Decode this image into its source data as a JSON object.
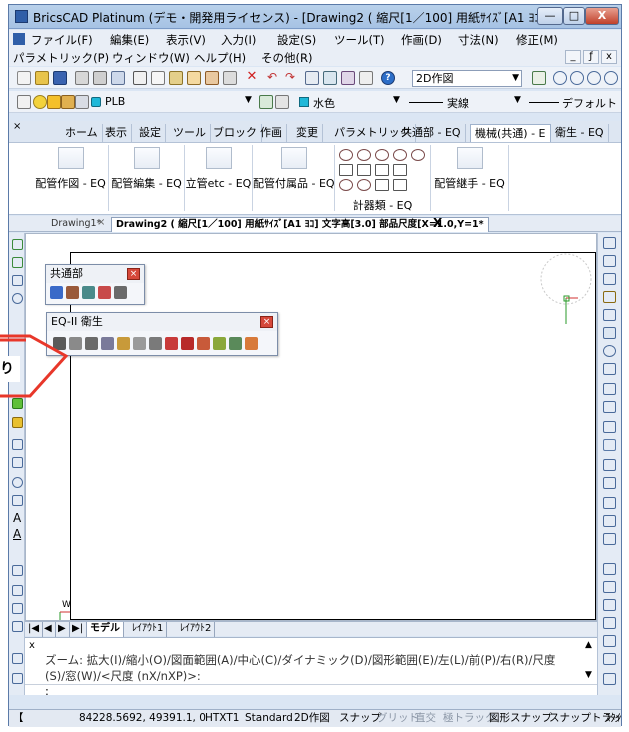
{
  "window": {
    "title": "BricsCAD Platinum (デモ・開発用ライセンス) - [Drawing2 ( 縮尺[1／100] 用紙ｻｲｽﾞ[A1 ﾖｺ] ...",
    "min": "—",
    "max": "□",
    "close": "X"
  },
  "menu": {
    "row1": [
      "ファイル(F)",
      "編集(E)",
      "表示(V)",
      "入力(I)",
      "設定(S)",
      "ツール(T)",
      "作画(D)",
      "寸法(N)",
      "修正(M)"
    ],
    "row2": [
      "パラメトリック(P)",
      "ウィンドウ(W)",
      "ヘルプ(H)",
      "その他(R)"
    ],
    "mdi_min": "_",
    "mdi_restore": "ƒ",
    "mdi_close": "x"
  },
  "toolbar1": {
    "workspace": "2D作図"
  },
  "toolbar2": {
    "layer": "PLB",
    "color": "水色",
    "linetype": "実線",
    "lineweight": "デフォルト"
  },
  "ribbon_tabs": [
    "ホーム",
    "表示",
    "設定",
    "ツール",
    "ブロック",
    "作画",
    "変更",
    "パラメトリック",
    "共通部 - EQ",
    "機械(共通) - E",
    "衛生 - EQ"
  ],
  "ribbon_active_tab": "機械(共通) - E",
  "ribbon_groups": [
    "配管作図 - EQ",
    "配管編集 - EQ",
    "立管etc - EQ",
    "配管付属品 - EQ",
    "計器類 - EQ",
    "配管継手 - EQ"
  ],
  "doc_tabs": [
    "Drawing1*",
    "Drawing2 ( 縮尺[1／100] 用紙ｻｲｽﾞ[A1 ﾖｺ] 文字高[3.0] 部品尺度[X=1.0,Y=1* "
  ],
  "doc_close": "X",
  "panels": {
    "common": {
      "title": "共通部"
    },
    "sanitary": {
      "title": "EQ-II 衛生"
    }
  },
  "callout_text": "り",
  "layout_tabs": [
    "モデル",
    "ﾚｲｱｳﾄ1",
    "ﾚｲｱｳﾄ2"
  ],
  "command": {
    "prompt_x": "x",
    "line1": "ズーム: 拡大(I)/縮小(O)/図面範囲(A)/中心(C)/ダイナミック(D)/図形範囲(E)/左(L)/前(P)/右(R)/尺度",
    "line2": "(S)/窓(W)/<尺度 (nX/nXP)>:",
    "input": ":"
  },
  "status": {
    "coords": "84228.5692, 49391.1, 0",
    "items": [
      "HTXT1",
      "Standard",
      "2D作図",
      "スナップ",
      "グリッド",
      "直交",
      "極トラック",
      "図形スナップ",
      "スナップトラック",
      "ｽﾀｲﾙ"
    ],
    "dim_items": [
      "グリッド",
      "直交",
      "極トラック"
    ]
  },
  "ucs_label": "W",
  "colors": {
    "accent_red": "#e8372a",
    "title_blue": "#b9d1ea",
    "drawing_bg": "#ffffff"
  }
}
